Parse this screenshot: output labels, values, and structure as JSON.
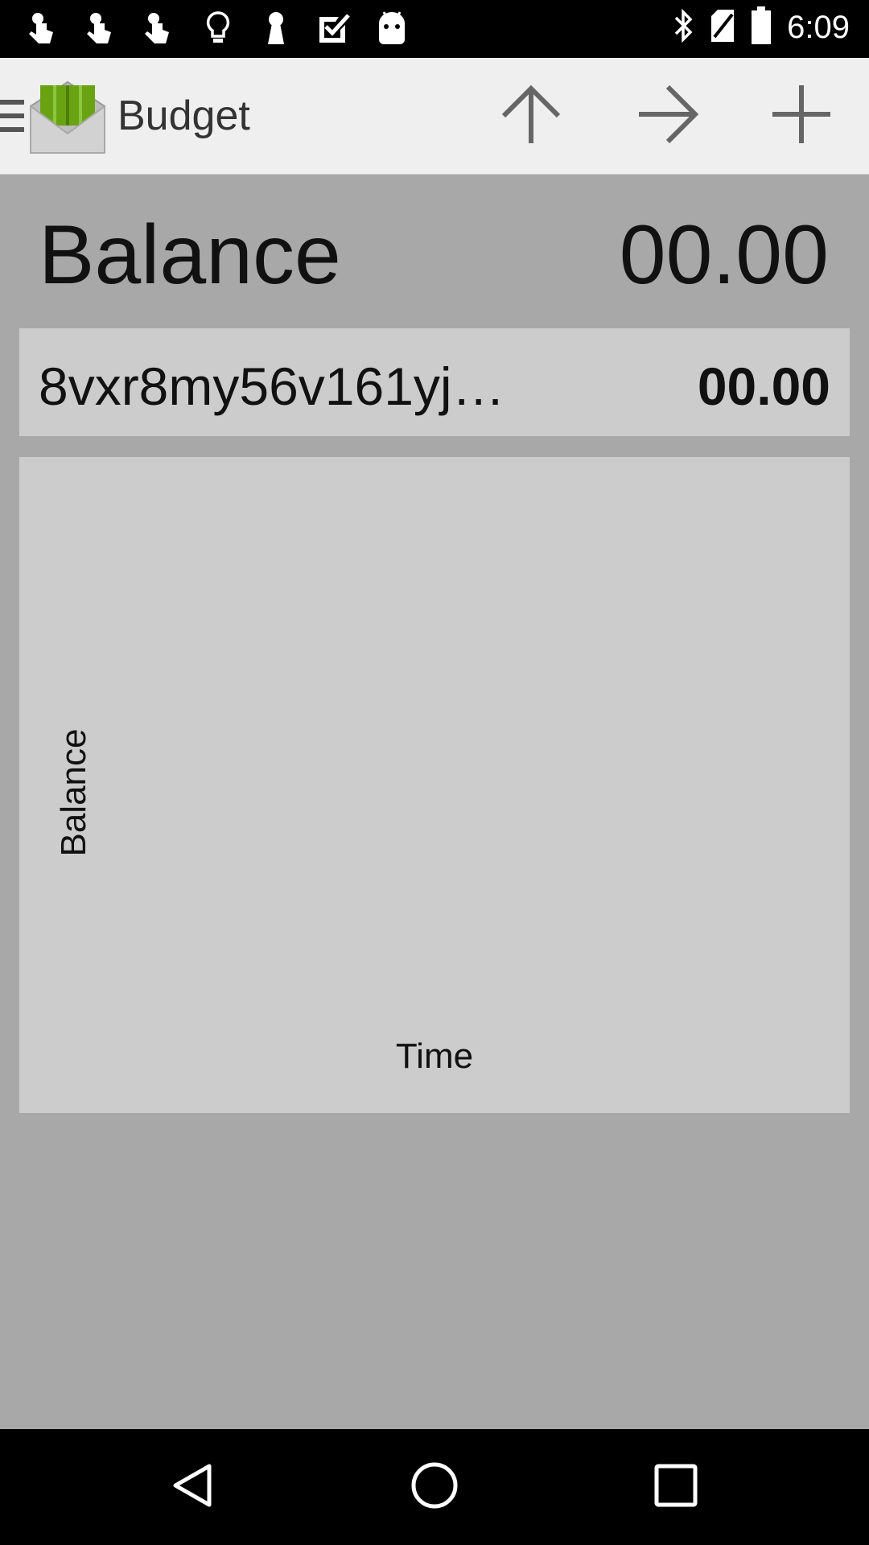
{
  "status_bar": {
    "time": "6:09",
    "notification_icons": [
      "touch-icon",
      "touch-icon",
      "touch-icon",
      "lightbulb-icon",
      "keyhole-icon",
      "checkbox-icon",
      "android-icon"
    ],
    "system_icons": [
      "bluetooth-icon",
      "no-sim-icon",
      "battery-icon"
    ]
  },
  "action_bar": {
    "title": "Budget",
    "actions": [
      "arrow-up-icon",
      "arrow-right-icon",
      "plus-icon"
    ]
  },
  "summary": {
    "label": "Balance",
    "value": "00.00"
  },
  "account": {
    "name": "8vxr8my56v161yj…",
    "amount": "00.00"
  },
  "graph": {
    "y_label": "Balance",
    "x_label": "Time"
  },
  "colors": {
    "background": "#a8a8a8",
    "card": "#cccccc",
    "action_bar": "#efefef",
    "logo_green": "#6aa312"
  }
}
